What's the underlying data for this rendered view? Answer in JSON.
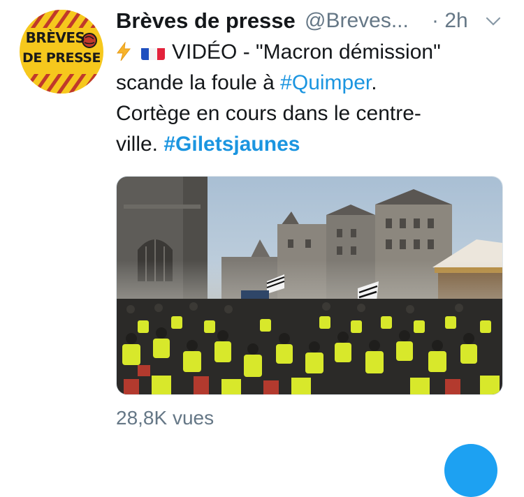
{
  "avatar": {
    "line1": "BRÈVES",
    "line2": "DE PRESSE"
  },
  "tweet": {
    "author_name": "Brèves de presse",
    "handle": "@Breves...",
    "time": "· 2h",
    "line1_text": "VIDÉO - \"Macron démission\"",
    "line2_text": "scande la foule à ",
    "line2_hashtag": "#Quimper",
    "line2_end": ".",
    "line3_text": "Cortège en cours dans le centre-",
    "line4_text": "ville. ",
    "line4_hashtag": "#Giletsjaunes",
    "views": "28,8K vues"
  },
  "icons": {
    "bolt": "lightning-bolt-icon",
    "flag": "france-flag-icon",
    "chevron": "chevron-down-icon"
  },
  "colors": {
    "link": "#1b95e0",
    "secondary": "#657786",
    "vest": "#d8e82b",
    "avatar_bg": "#f6c81d"
  }
}
